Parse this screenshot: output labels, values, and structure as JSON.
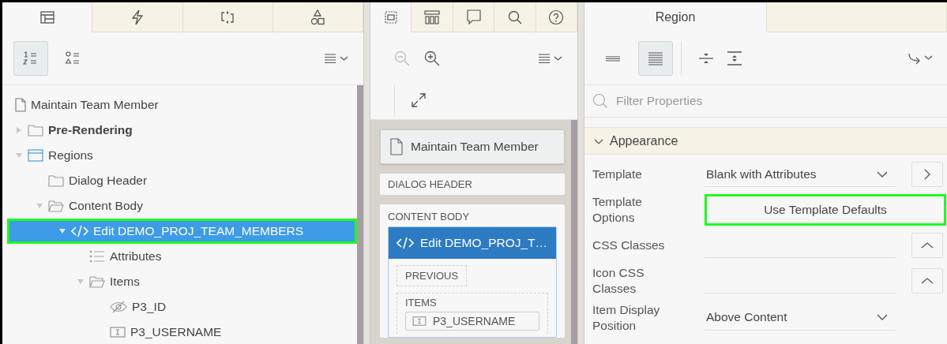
{
  "left_panel": {
    "tabs": [
      {
        "kind": "layout",
        "selected": true
      },
      {
        "kind": "bolt",
        "selected": false
      },
      {
        "kind": "swap",
        "selected": false
      },
      {
        "kind": "shapes",
        "selected": false
      }
    ],
    "view_buttons": [
      {
        "kind": "numbered",
        "selected": true
      },
      {
        "kind": "symbols",
        "selected": false
      }
    ],
    "tree": [
      {
        "label": "Maintain Team Member",
        "kind": "page",
        "bold": false,
        "selected": false,
        "highlighted": false
      },
      {
        "label": "Pre-Rendering",
        "kind": "folder",
        "bold": true,
        "expanded": false,
        "selected": false,
        "highlighted": false
      },
      {
        "label": "Regions",
        "kind": "region",
        "bold": false,
        "expanded": true,
        "selected": false,
        "highlighted": false,
        "children": [
          {
            "label": "Dialog Header",
            "kind": "folder",
            "bold": false,
            "selected": false,
            "highlighted": false
          },
          {
            "label": "Content Body",
            "kind": "folder-open",
            "bold": false,
            "expanded": true,
            "selected": false,
            "highlighted": false,
            "children": [
              {
                "label": "Edit DEMO_PROJ_TEAM_MEMBERS",
                "kind": "code",
                "bold": false,
                "expanded": true,
                "selected": true,
                "highlighted": true,
                "children": [
                  {
                    "label": "Attributes",
                    "kind": "list",
                    "bold": false,
                    "selected": false,
                    "highlighted": false
                  },
                  {
                    "label": "Items",
                    "kind": "folder-open",
                    "bold": false,
                    "expanded": true,
                    "selected": false,
                    "highlighted": false,
                    "children": [
                      {
                        "label": "P3_ID",
                        "kind": "hidden",
                        "bold": false,
                        "selected": false,
                        "highlighted": false
                      },
                      {
                        "label": "P3_USERNAME",
                        "kind": "textfield",
                        "bold": false,
                        "selected": false,
                        "highlighted": false
                      }
                    ]
                  }
                ]
              }
            ]
          }
        ]
      }
    ]
  },
  "middle_panel": {
    "tabs": [
      {
        "kind": "grid",
        "selected": true
      },
      {
        "kind": "gallery",
        "selected": false
      },
      {
        "kind": "comment",
        "selected": false
      },
      {
        "kind": "search",
        "selected": false
      },
      {
        "kind": "help",
        "selected": false
      }
    ],
    "zoom_buttons": [
      {
        "kind": "zoom-out",
        "disabled": true
      },
      {
        "kind": "zoom-in",
        "disabled": false
      }
    ],
    "page_card": "Maintain Team Member",
    "dialog_header": "DIALOG HEADER",
    "content_body": {
      "title": "CONTENT BODY",
      "region": {
        "title": "Edit DEMO_PROJ_T…",
        "previous": "PREVIOUS",
        "items_title": "ITEMS",
        "items": [
          "P3_USERNAME"
        ]
      }
    }
  },
  "right_panel": {
    "tabs": [
      {
        "label": "Region",
        "selected": true
      },
      {
        "selected": false
      }
    ],
    "view_buttons": [
      {
        "kind": "lines",
        "selected": false
      },
      {
        "kind": "dense",
        "selected": true
      }
    ],
    "filter": {
      "placeholder": "Filter Properties"
    },
    "section": {
      "title": "Appearance",
      "expanded": true
    },
    "properties": [
      {
        "label": "Template",
        "kind": "select",
        "value": "Blank with Attributes",
        "action": {
          "kind": "chevron-right"
        }
      },
      {
        "label": "Template Options",
        "kind": "button",
        "value": "Use Template Defaults",
        "highlighted": true
      },
      {
        "label": "CSS Classes",
        "kind": "text",
        "action": {
          "kind": "caret-up"
        }
      },
      {
        "label": "Icon CSS Classes",
        "kind": "text",
        "action": {
          "kind": "caret-up"
        }
      },
      {
        "label": "Item Display Position",
        "kind": "select",
        "value": "Above Content"
      }
    ]
  }
}
